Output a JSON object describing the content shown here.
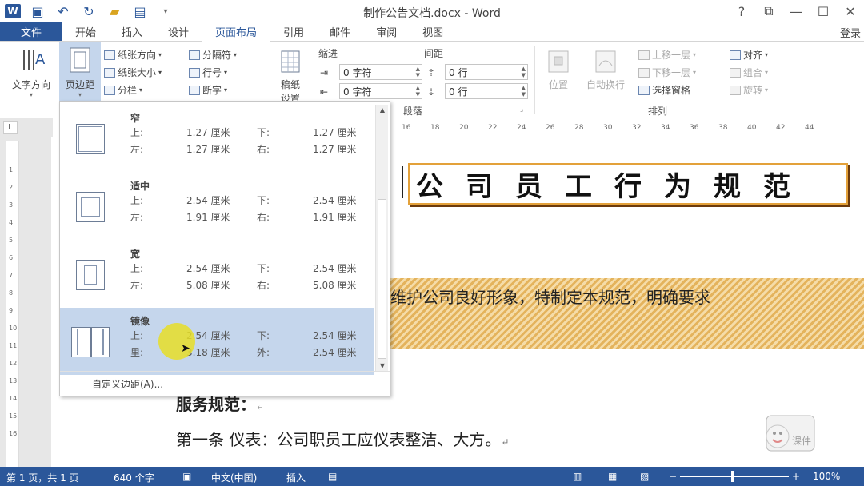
{
  "titlebar": {
    "logo": "W",
    "doc_title": "制作公告文档.docx - Word",
    "help": "?",
    "restore_ribbon": "⧉",
    "minimize": "—",
    "maximize": "☐",
    "close": "✕"
  },
  "tabs": [
    "文件",
    "开始",
    "插入",
    "设计",
    "页面布局",
    "引用",
    "邮件",
    "审阅",
    "视图"
  ],
  "active_tab": "页面布局",
  "login": "登录",
  "ribbon": {
    "text_direction": "文字方向",
    "margins": "页边距",
    "orientation": "纸张方向",
    "size": "纸张大小",
    "columns": "分栏",
    "breaks": "分隔符",
    "line_numbers": "行号",
    "hyphenation": "断字",
    "paper_setup": "稿纸\n设置",
    "paper_setup_l1": "稿纸",
    "paper_setup_l2": "设置",
    "indent_label": "缩进",
    "spacing_label": "间距",
    "indent_left": "0 字符",
    "indent_right": "0 字符",
    "spacing_before": "0 行",
    "spacing_after": "0 行",
    "paragraph_group": "段落",
    "position": "位置",
    "wrap_text": "自动换行",
    "bring_forward": "上移一层",
    "send_backward": "下移一层",
    "selection_pane": "选择窗格",
    "align": "对齐",
    "group": "组合",
    "rotate": "旋转",
    "arrange_group": "排列"
  },
  "margins_menu": {
    "options": [
      {
        "name": "窄",
        "l1": "上:",
        "v1": "1.27 厘米",
        "l2": "下:",
        "v2": "1.27 厘米",
        "l3": "左:",
        "v3": "1.27 厘米",
        "l4": "右:",
        "v4": "1.27 厘米"
      },
      {
        "name": "适中",
        "l1": "上:",
        "v1": "2.54 厘米",
        "l2": "下:",
        "v2": "2.54 厘米",
        "l3": "左:",
        "v3": "1.91 厘米",
        "l4": "右:",
        "v4": "1.91 厘米"
      },
      {
        "name": "宽",
        "l1": "上:",
        "v1": "2.54 厘米",
        "l2": "下:",
        "v2": "2.54 厘米",
        "l3": "左:",
        "v3": "5.08 厘米",
        "l4": "右:",
        "v4": "5.08 厘米"
      },
      {
        "name": "镜像",
        "l1": "上:",
        "v1": "2.54 厘米",
        "l2": "下:",
        "v2": "2.54 厘米",
        "l3": "里:",
        "v3": "3.18 厘米",
        "l4": "外:",
        "v4": "2.54 厘米"
      }
    ],
    "selected": "镜像",
    "custom": "自定义边距(A)..."
  },
  "ruler_top": [
    "16",
    "18",
    "20",
    "22",
    "24",
    "26",
    "28",
    "30",
    "32",
    "34",
    "36",
    "38",
    "40",
    "42",
    "44"
  ],
  "ruler_left": [
    "1",
    "2",
    "3",
    "4",
    "5",
    "6",
    "7",
    "8",
    "9",
    "10",
    "11",
    "12",
    "13",
    "14",
    "15",
    "16"
  ],
  "ruler_corner": "L",
  "document": {
    "title": "公司员工行为规范",
    "hatched_text": "维护公司良好形象，特制定本规范，明确要求",
    "heading": "服务规范：",
    "article": "第一条   仪表：公司职员工应仪表整洁、大方。",
    "para_mark": "↵"
  },
  "watermark_text": "课件",
  "statusbar": {
    "page": "第 1 页，共 1 页",
    "words": "640 个字",
    "language": "中文(中国)",
    "mode": "插入",
    "zoom": "100%"
  },
  "colors": {
    "accent": "#2b579a",
    "selected_option": "#c5d6ec",
    "title_border": "#e3a13a"
  }
}
